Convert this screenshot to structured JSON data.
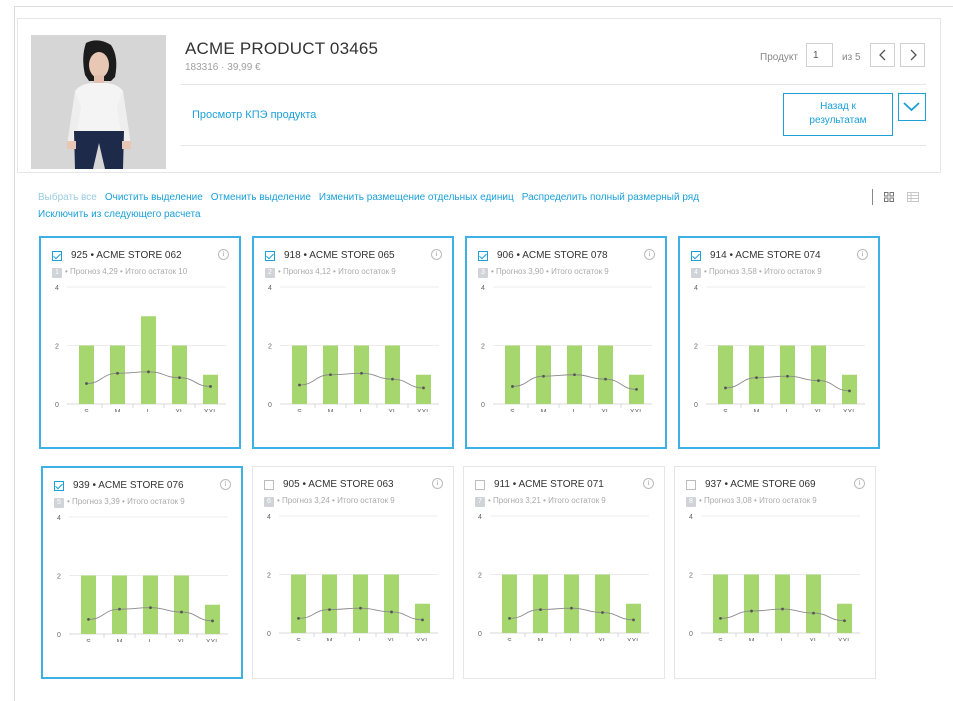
{
  "product": {
    "title": "ACME PRODUCT 03465",
    "subtitle": "183316 · 39,99 €",
    "kpi_link": "Просмотр КПЭ продукта"
  },
  "pager": {
    "label": "Продукт",
    "current": "1",
    "of_label": "из 5",
    "prev_icon": "chevron-left-icon",
    "next_icon": "chevron-right-icon"
  },
  "buttons": {
    "back_line1": "Назад к",
    "back_line2": "результатам",
    "expand_icon": "chevron-down-icon"
  },
  "actions": {
    "select_all": "Выбрать все",
    "clear_selection": "Очистить выделение",
    "cancel_selection": "Отменить выделение",
    "change_placement": "Изменить размещение отдельных единиц",
    "distribute": "Распределить полный размерный ряд",
    "exclude": "Исключить из следующего расчета"
  },
  "view_toggle": {
    "grid_icon": "grid-view-icon",
    "list_icon": "list-view-icon"
  },
  "colors": {
    "accent": "#1ba0d8",
    "bar": "#a6d66e",
    "line": "#8a8a8a",
    "grid": "#ececec"
  },
  "cards": [
    {
      "title": "925 • ACME STORE 062",
      "rank": "1",
      "summary": "• Прогноз 4,29 • Итого остаток 10",
      "selected": true
    },
    {
      "title": "918 • ACME STORE 065",
      "rank": "2",
      "summary": "• Прогноз 4,12 • Итого остаток 9",
      "selected": true
    },
    {
      "title": "906 • ACME STORE 078",
      "rank": "3",
      "summary": "• Прогноз 3,90 • Итого остаток 9",
      "selected": true
    },
    {
      "title": "914 • ACME STORE 074",
      "rank": "4",
      "summary": "• Прогноз 3,58 • Итого остаток 9",
      "selected": true
    },
    {
      "title": "939 • ACME STORE 076",
      "rank": "5",
      "summary": "• Прогноз 3,39 • Итого остаток 9",
      "selected": true
    },
    {
      "title": "905 • ACME STORE 063",
      "rank": "6",
      "summary": "• Прогноз 3,24 • Итого остаток 9",
      "selected": false
    },
    {
      "title": "911 • ACME STORE 071",
      "rank": "7",
      "summary": "• Прогноз 3,21 • Итого остаток 9",
      "selected": false
    },
    {
      "title": "937 • ACME STORE 069",
      "rank": "8",
      "summary": "• Прогноз 3,08 • Итого остаток 9",
      "selected": false
    }
  ],
  "chart_data": [
    {
      "type": "bar",
      "categories": [
        "S",
        "M",
        "L",
        "XL",
        "XXL"
      ],
      "ylim": [
        0,
        4
      ],
      "yticks": [
        "0",
        "2",
        "4"
      ],
      "series": [
        {
          "type": "bar",
          "values": [
            2,
            2,
            3,
            2,
            1
          ]
        },
        {
          "type": "line",
          "values": [
            0.7,
            1.05,
            1.1,
            0.9,
            0.6
          ]
        }
      ]
    },
    {
      "type": "bar",
      "categories": [
        "S",
        "M",
        "L",
        "XL",
        "XXL"
      ],
      "ylim": [
        0,
        4
      ],
      "yticks": [
        "0",
        "2",
        "4"
      ],
      "series": [
        {
          "type": "bar",
          "values": [
            2,
            2,
            2,
            2,
            1
          ]
        },
        {
          "type": "line",
          "values": [
            0.65,
            1.0,
            1.05,
            0.85,
            0.55
          ]
        }
      ]
    },
    {
      "type": "bar",
      "categories": [
        "S",
        "M",
        "L",
        "XL",
        "XXL"
      ],
      "ylim": [
        0,
        4
      ],
      "yticks": [
        "0",
        "2",
        "4"
      ],
      "series": [
        {
          "type": "bar",
          "values": [
            2,
            2,
            2,
            2,
            1
          ]
        },
        {
          "type": "line",
          "values": [
            0.6,
            0.95,
            1.0,
            0.85,
            0.5
          ]
        }
      ]
    },
    {
      "type": "bar",
      "categories": [
        "S",
        "M",
        "L",
        "XL",
        "XXL"
      ],
      "ylim": [
        0,
        4
      ],
      "yticks": [
        "0",
        "2",
        "4"
      ],
      "series": [
        {
          "type": "bar",
          "values": [
            2,
            2,
            2,
            2,
            1
          ]
        },
        {
          "type": "line",
          "values": [
            0.55,
            0.9,
            0.95,
            0.8,
            0.45
          ]
        }
      ]
    },
    {
      "type": "bar",
      "categories": [
        "S",
        "M",
        "L",
        "XL",
        "XXL"
      ],
      "ylim": [
        0,
        4
      ],
      "yticks": [
        "0",
        "2",
        "4"
      ],
      "series": [
        {
          "type": "bar",
          "values": [
            2,
            2,
            2,
            2,
            1
          ]
        },
        {
          "type": "line",
          "values": [
            0.5,
            0.85,
            0.9,
            0.75,
            0.45
          ]
        }
      ]
    },
    {
      "type": "bar",
      "categories": [
        "S",
        "M",
        "L",
        "XL",
        "XXL"
      ],
      "ylim": [
        0,
        4
      ],
      "yticks": [
        "0",
        "2",
        "4"
      ],
      "series": [
        {
          "type": "bar",
          "values": [
            2,
            2,
            2,
            2,
            1
          ]
        },
        {
          "type": "line",
          "values": [
            0.5,
            0.8,
            0.85,
            0.72,
            0.45
          ]
        }
      ]
    },
    {
      "type": "bar",
      "categories": [
        "S",
        "M",
        "L",
        "XL",
        "XXL"
      ],
      "ylim": [
        0,
        4
      ],
      "yticks": [
        "0",
        "2",
        "4"
      ],
      "series": [
        {
          "type": "bar",
          "values": [
            2,
            2,
            2,
            2,
            1
          ]
        },
        {
          "type": "line",
          "values": [
            0.5,
            0.8,
            0.85,
            0.7,
            0.45
          ]
        }
      ]
    },
    {
      "type": "bar",
      "categories": [
        "S",
        "M",
        "L",
        "XL",
        "XXL"
      ],
      "ylim": [
        0,
        4
      ],
      "yticks": [
        "0",
        "2",
        "4"
      ],
      "series": [
        {
          "type": "bar",
          "values": [
            2,
            2,
            2,
            2,
            1
          ]
        },
        {
          "type": "line",
          "values": [
            0.5,
            0.75,
            0.82,
            0.68,
            0.42
          ]
        }
      ]
    }
  ]
}
